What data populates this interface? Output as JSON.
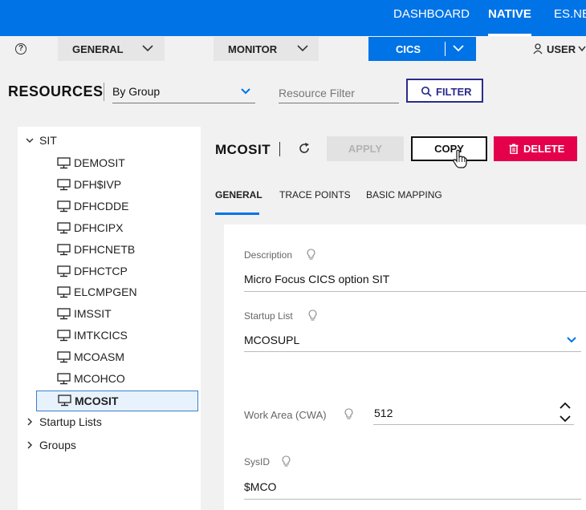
{
  "topnav": {
    "dashboard": "DASHBOARD",
    "native": "NATIVE",
    "esnet": "ES.NE"
  },
  "menubar": {
    "general": "GENERAL",
    "monitor": "MONITOR",
    "cics": "CICS",
    "user": "USER"
  },
  "resources": {
    "title": "RESOURCES",
    "group_select_value": "By Group",
    "filter_placeholder": "Resource Filter",
    "filter_button": "FILTER"
  },
  "tree": {
    "root": "SIT",
    "items": [
      "DEMOSIT",
      "DFH$IVP",
      "DFHCDDE",
      "DFHCIPX",
      "DFHCNETB",
      "DFHCTCP",
      "ELCMPGEN",
      "IMSSIT",
      "IMTKCICS",
      "MCOASM",
      "MCOHCO",
      "MCOSIT"
    ],
    "selected": "MCOSIT",
    "groups": [
      "Startup Lists",
      "Groups"
    ]
  },
  "detail": {
    "title": "MCOSIT",
    "apply": "APPLY",
    "copy": "COPY",
    "delete": "DELETE",
    "tabs": [
      "GENERAL",
      "TRACE POINTS",
      "BASIC MAPPING"
    ],
    "fields": {
      "description_label": "Description",
      "description_value": "Micro Focus CICS option SIT",
      "startup_list_label": "Startup List",
      "startup_list_value": "MCOSUPL",
      "work_area_label": "Work Area (CWA)",
      "work_area_value": "512",
      "sysid_label": "SysID",
      "sysid_value": "$MCO"
    }
  },
  "colors": {
    "brand_blue": "#0073e7",
    "delete_red": "#e5004c",
    "filter_navy": "#2b2b8a"
  }
}
